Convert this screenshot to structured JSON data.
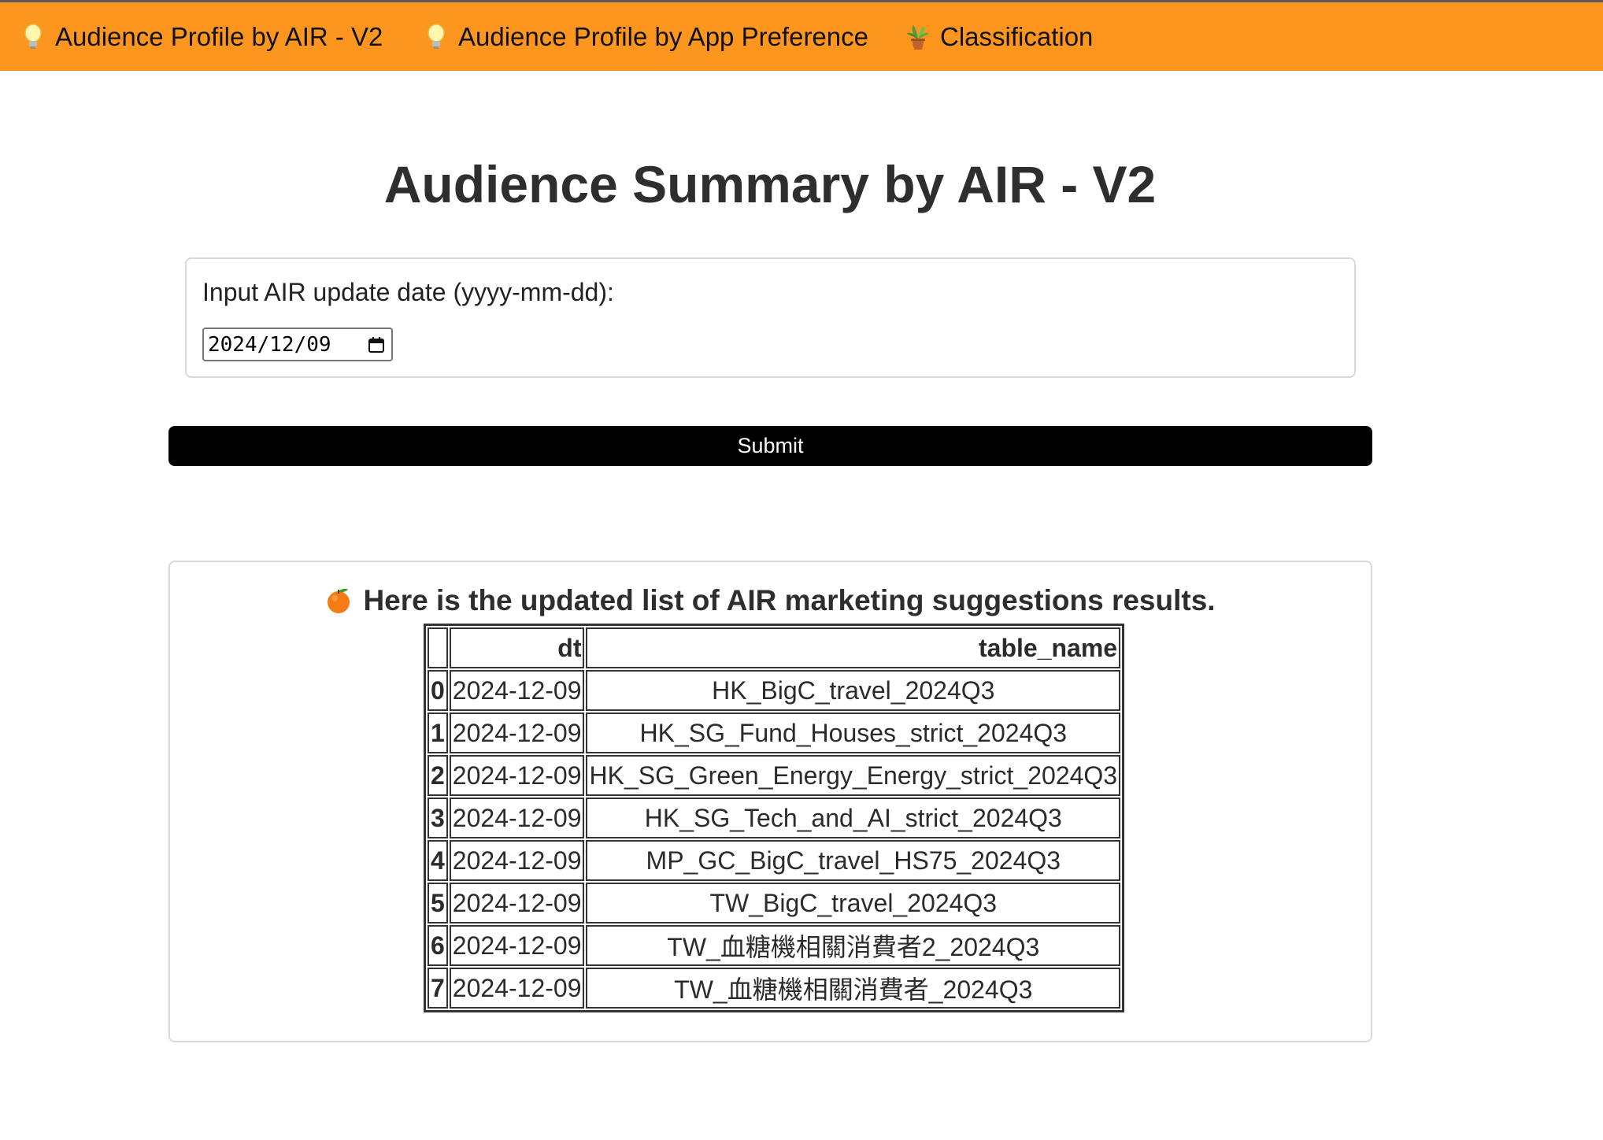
{
  "nav": {
    "items": [
      {
        "label": "Audience Profile by AIR - V2",
        "icon": "lightbulb-icon"
      },
      {
        "label": "Audience Profile by App Preference",
        "icon": "lightbulb-icon"
      },
      {
        "label": "Classification",
        "icon": "potted-plant-icon"
      }
    ],
    "background": "#fd961e"
  },
  "page": {
    "title": "Audience Summary by AIR - V2"
  },
  "form": {
    "date_label": "Input AIR update date (yyyy-mm-dd):",
    "date_value": "2024/12/09",
    "submit_label": "Submit"
  },
  "results": {
    "heading": "Here is the updated list of AIR marketing suggestions results.",
    "heading_icon": "tangerine-icon",
    "columns": [
      "",
      "dt",
      "table_name"
    ],
    "rows": [
      {
        "index": "0",
        "dt": "2024-12-09",
        "table_name": "HK_BigC_travel_2024Q3"
      },
      {
        "index": "1",
        "dt": "2024-12-09",
        "table_name": "HK_SG_Fund_Houses_strict_2024Q3"
      },
      {
        "index": "2",
        "dt": "2024-12-09",
        "table_name": "HK_SG_Green_Energy_Energy_strict_2024Q3"
      },
      {
        "index": "3",
        "dt": "2024-12-09",
        "table_name": "HK_SG_Tech_and_AI_strict_2024Q3"
      },
      {
        "index": "4",
        "dt": "2024-12-09",
        "table_name": "MP_GC_BigC_travel_HS75_2024Q3"
      },
      {
        "index": "5",
        "dt": "2024-12-09",
        "table_name": "TW_BigC_travel_2024Q3"
      },
      {
        "index": "6",
        "dt": "2024-12-09",
        "table_name": "TW_血糖機相關消費者2_2024Q3"
      },
      {
        "index": "7",
        "dt": "2024-12-09",
        "table_name": "TW_血糖機相關消費者_2024Q3"
      }
    ]
  }
}
